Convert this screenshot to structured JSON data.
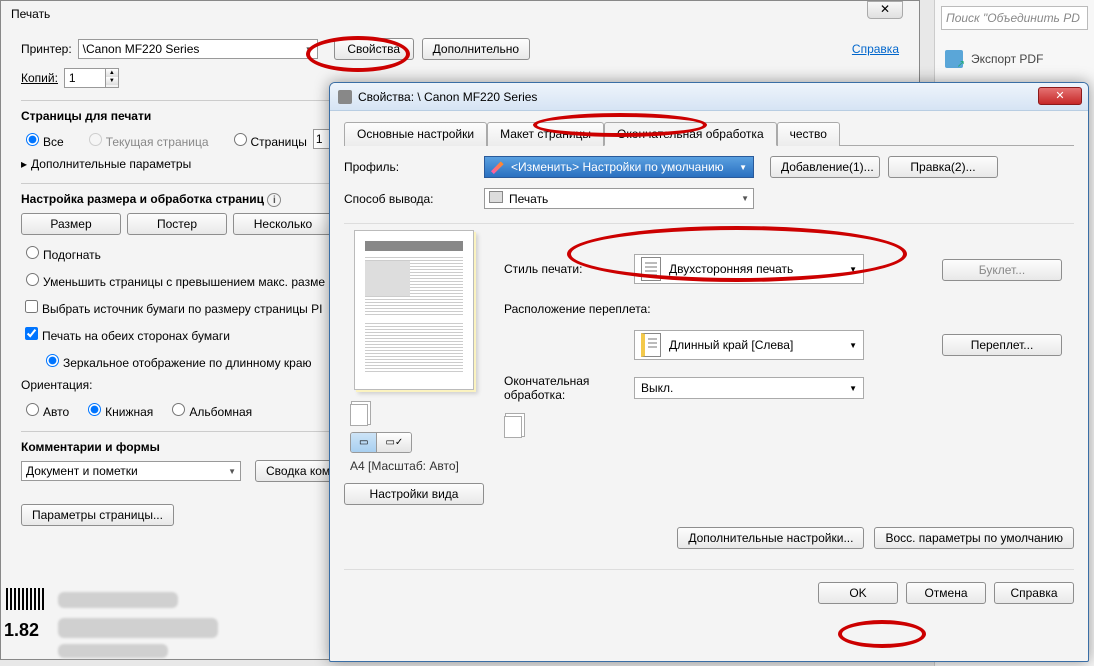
{
  "print": {
    "title": "Печать",
    "printer_label": "Принтер:",
    "printer_value": "\\Canon MF220 Series",
    "properties_btn": "Свойства",
    "advanced_btn": "Дополнительно",
    "help_link": "Справка",
    "copies_label": "Копий:",
    "copies_value": "1",
    "pages_section": "Страницы для печати",
    "radio_all": "Все",
    "radio_current": "Текущая страница",
    "radio_pages": "Страницы",
    "pages_from": "1",
    "more_params": "Дополнительные параметры",
    "size_section": "Настройка размера и обработка страниц",
    "btn_size": "Размер",
    "btn_poster": "Постер",
    "btn_multiple": "Несколько",
    "fit": "Подогнать",
    "shrink": "Уменьшить страницы с превышением макс. разме",
    "paper_source": "Выбрать источник бумаги по размеру страницы PI",
    "duplex": "Печать на обеих сторонах бумаги",
    "mirror": "Зеркальное отображение по длинному краю",
    "orientation_label": "Ориентация:",
    "orient_auto": "Авто",
    "orient_portrait": "Книжная",
    "orient_landscape": "Альбомная",
    "comments_section": "Комментарии и формы",
    "comments_value": "Документ и пометки",
    "summary_btn": "Сводка ком",
    "page_params_btn": "Параметры страницы..."
  },
  "side": {
    "search_placeholder": "Поиск \"Объединить PD",
    "export": "Экспорт PDF"
  },
  "props": {
    "title": "Свойства: \\            Canon MF220 Series",
    "tabs": {
      "basic": "Основные настройки",
      "layout": "Макет страницы",
      "finishing": "Окончательная обработка",
      "quality": "чество"
    },
    "profile_label": "Профиль:",
    "profile_value": "<Изменить> Настройки по умолчанию",
    "add_btn": "Добавление(1)...",
    "edit_btn": "Правка(2)...",
    "output_label": "Способ вывода:",
    "output_value": "Печать",
    "style_label": "Стиль печати:",
    "style_value": "Двухсторонняя печать",
    "booklet_btn": "Буклет...",
    "binding_label": "Расположение переплета:",
    "binding_value": "Длинный край [Слева]",
    "binding_btn": "Переплет...",
    "finishing_label": "Окончательная обработка:",
    "finishing_value": "Выкл.",
    "preview_caption": "A4 [Масштаб: Авто]",
    "view_settings_btn": "Настройки вида",
    "adv_settings_btn": "Дополнительные настройки...",
    "restore_btn": "Восс. параметры по умолчанию",
    "ok": "OK",
    "cancel": "Отмена",
    "help": "Справка"
  },
  "misc": {
    "price": "1.82"
  }
}
